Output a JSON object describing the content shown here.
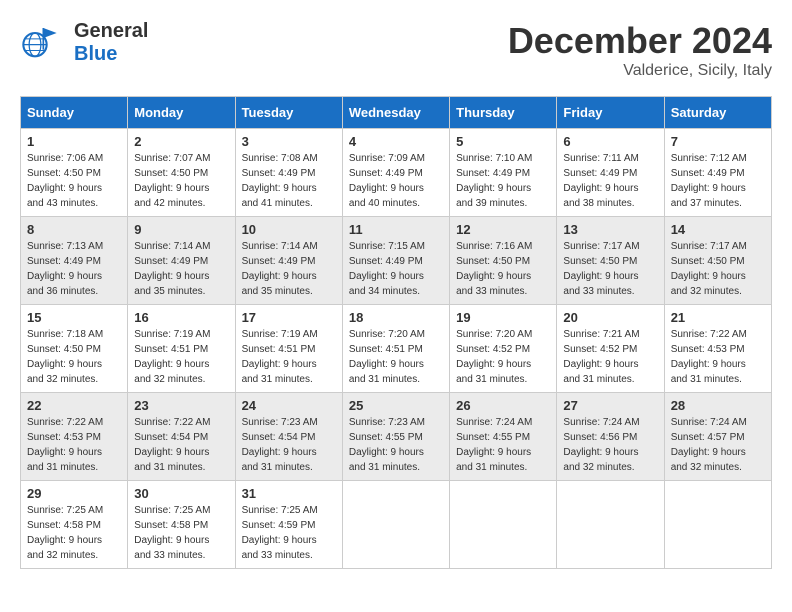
{
  "header": {
    "logo_general": "General",
    "logo_blue": "Blue",
    "month": "December 2024",
    "location": "Valderice, Sicily, Italy"
  },
  "weekdays": [
    "Sunday",
    "Monday",
    "Tuesday",
    "Wednesday",
    "Thursday",
    "Friday",
    "Saturday"
  ],
  "weeks": [
    [
      {
        "day": "1",
        "sunrise": "Sunrise: 7:06 AM",
        "sunset": "Sunset: 4:50 PM",
        "daylight": "Daylight: 9 hours and 43 minutes."
      },
      {
        "day": "2",
        "sunrise": "Sunrise: 7:07 AM",
        "sunset": "Sunset: 4:50 PM",
        "daylight": "Daylight: 9 hours and 42 minutes."
      },
      {
        "day": "3",
        "sunrise": "Sunrise: 7:08 AM",
        "sunset": "Sunset: 4:49 PM",
        "daylight": "Daylight: 9 hours and 41 minutes."
      },
      {
        "day": "4",
        "sunrise": "Sunrise: 7:09 AM",
        "sunset": "Sunset: 4:49 PM",
        "daylight": "Daylight: 9 hours and 40 minutes."
      },
      {
        "day": "5",
        "sunrise": "Sunrise: 7:10 AM",
        "sunset": "Sunset: 4:49 PM",
        "daylight": "Daylight: 9 hours and 39 minutes."
      },
      {
        "day": "6",
        "sunrise": "Sunrise: 7:11 AM",
        "sunset": "Sunset: 4:49 PM",
        "daylight": "Daylight: 9 hours and 38 minutes."
      },
      {
        "day": "7",
        "sunrise": "Sunrise: 7:12 AM",
        "sunset": "Sunset: 4:49 PM",
        "daylight": "Daylight: 9 hours and 37 minutes."
      }
    ],
    [
      {
        "day": "8",
        "sunrise": "Sunrise: 7:13 AM",
        "sunset": "Sunset: 4:49 PM",
        "daylight": "Daylight: 9 hours and 36 minutes."
      },
      {
        "day": "9",
        "sunrise": "Sunrise: 7:14 AM",
        "sunset": "Sunset: 4:49 PM",
        "daylight": "Daylight: 9 hours and 35 minutes."
      },
      {
        "day": "10",
        "sunrise": "Sunrise: 7:14 AM",
        "sunset": "Sunset: 4:49 PM",
        "daylight": "Daylight: 9 hours and 35 minutes."
      },
      {
        "day": "11",
        "sunrise": "Sunrise: 7:15 AM",
        "sunset": "Sunset: 4:49 PM",
        "daylight": "Daylight: 9 hours and 34 minutes."
      },
      {
        "day": "12",
        "sunrise": "Sunrise: 7:16 AM",
        "sunset": "Sunset: 4:50 PM",
        "daylight": "Daylight: 9 hours and 33 minutes."
      },
      {
        "day": "13",
        "sunrise": "Sunrise: 7:17 AM",
        "sunset": "Sunset: 4:50 PM",
        "daylight": "Daylight: 9 hours and 33 minutes."
      },
      {
        "day": "14",
        "sunrise": "Sunrise: 7:17 AM",
        "sunset": "Sunset: 4:50 PM",
        "daylight": "Daylight: 9 hours and 32 minutes."
      }
    ],
    [
      {
        "day": "15",
        "sunrise": "Sunrise: 7:18 AM",
        "sunset": "Sunset: 4:50 PM",
        "daylight": "Daylight: 9 hours and 32 minutes."
      },
      {
        "day": "16",
        "sunrise": "Sunrise: 7:19 AM",
        "sunset": "Sunset: 4:51 PM",
        "daylight": "Daylight: 9 hours and 32 minutes."
      },
      {
        "day": "17",
        "sunrise": "Sunrise: 7:19 AM",
        "sunset": "Sunset: 4:51 PM",
        "daylight": "Daylight: 9 hours and 31 minutes."
      },
      {
        "day": "18",
        "sunrise": "Sunrise: 7:20 AM",
        "sunset": "Sunset: 4:51 PM",
        "daylight": "Daylight: 9 hours and 31 minutes."
      },
      {
        "day": "19",
        "sunrise": "Sunrise: 7:20 AM",
        "sunset": "Sunset: 4:52 PM",
        "daylight": "Daylight: 9 hours and 31 minutes."
      },
      {
        "day": "20",
        "sunrise": "Sunrise: 7:21 AM",
        "sunset": "Sunset: 4:52 PM",
        "daylight": "Daylight: 9 hours and 31 minutes."
      },
      {
        "day": "21",
        "sunrise": "Sunrise: 7:22 AM",
        "sunset": "Sunset: 4:53 PM",
        "daylight": "Daylight: 9 hours and 31 minutes."
      }
    ],
    [
      {
        "day": "22",
        "sunrise": "Sunrise: 7:22 AM",
        "sunset": "Sunset: 4:53 PM",
        "daylight": "Daylight: 9 hours and 31 minutes."
      },
      {
        "day": "23",
        "sunrise": "Sunrise: 7:22 AM",
        "sunset": "Sunset: 4:54 PM",
        "daylight": "Daylight: 9 hours and 31 minutes."
      },
      {
        "day": "24",
        "sunrise": "Sunrise: 7:23 AM",
        "sunset": "Sunset: 4:54 PM",
        "daylight": "Daylight: 9 hours and 31 minutes."
      },
      {
        "day": "25",
        "sunrise": "Sunrise: 7:23 AM",
        "sunset": "Sunset: 4:55 PM",
        "daylight": "Daylight: 9 hours and 31 minutes."
      },
      {
        "day": "26",
        "sunrise": "Sunrise: 7:24 AM",
        "sunset": "Sunset: 4:55 PM",
        "daylight": "Daylight: 9 hours and 31 minutes."
      },
      {
        "day": "27",
        "sunrise": "Sunrise: 7:24 AM",
        "sunset": "Sunset: 4:56 PM",
        "daylight": "Daylight: 9 hours and 32 minutes."
      },
      {
        "day": "28",
        "sunrise": "Sunrise: 7:24 AM",
        "sunset": "Sunset: 4:57 PM",
        "daylight": "Daylight: 9 hours and 32 minutes."
      }
    ],
    [
      {
        "day": "29",
        "sunrise": "Sunrise: 7:25 AM",
        "sunset": "Sunset: 4:58 PM",
        "daylight": "Daylight: 9 hours and 32 minutes."
      },
      {
        "day": "30",
        "sunrise": "Sunrise: 7:25 AM",
        "sunset": "Sunset: 4:58 PM",
        "daylight": "Daylight: 9 hours and 33 minutes."
      },
      {
        "day": "31",
        "sunrise": "Sunrise: 7:25 AM",
        "sunset": "Sunset: 4:59 PM",
        "daylight": "Daylight: 9 hours and 33 minutes."
      },
      null,
      null,
      null,
      null
    ]
  ]
}
